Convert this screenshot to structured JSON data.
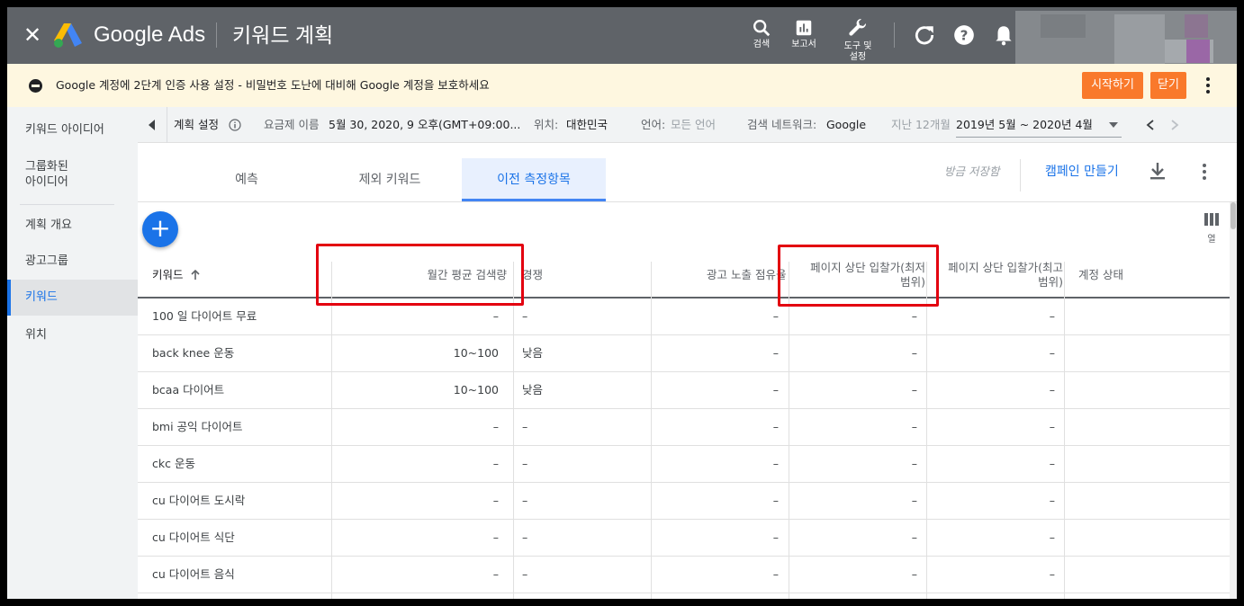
{
  "app": {
    "brand": "Google Ads",
    "page_title": "키워드 계획"
  },
  "toolbar": [
    {
      "label": "검색",
      "icon": "search-icon"
    },
    {
      "label": "보고서",
      "icon": "reports-icon"
    },
    {
      "label": "도구 및 설정",
      "icon": "wrench-icon"
    }
  ],
  "notice": {
    "text": "Google 계정에 2단계 인증 사용 설정 - 비밀번호 도난에 대비해 Google 계정을 보호하세요",
    "start_label": "시작하기",
    "close_label": "닫기"
  },
  "sidebar": {
    "items": [
      {
        "label": "키워드 아이디어"
      },
      {
        "label": "그룹화된\n아이디어"
      },
      {
        "label": "계획 개요"
      },
      {
        "label": "광고그룹"
      },
      {
        "label": "키워드",
        "active": true
      },
      {
        "label": "위치"
      }
    ]
  },
  "filter": {
    "plan_settings": "계획 설정",
    "plan_name_label": "요금제 이름",
    "plan_name": "5월 30, 2020, 9 오후(GMT+09:00...",
    "location_label": "위치:",
    "location": "대한민국",
    "language_label": "언어:",
    "language": "모든 언어",
    "network_label": "검색 네트워크:",
    "network": "Google",
    "period_label": "지난 12개월",
    "period": "2019년 5월 ~ 2020년 4월"
  },
  "tabs": [
    {
      "label": "예측"
    },
    {
      "label": "제외 키워드"
    },
    {
      "label": "이전 측정항목",
      "active": true
    }
  ],
  "actions": {
    "saved": "방금 저장함",
    "create_campaign": "캠페인 만들기",
    "columns_label": "열"
  },
  "table": {
    "headers": {
      "keyword": "키워드",
      "avg_searches": "월간 평균 검색량",
      "competition": "경쟁",
      "impression_share": "광고 노출 점유율",
      "bid_low": "페이지 상단 입찰가(최저\n범위)",
      "bid_high": "페이지 상단 입찰가(최고\n범위)",
      "status": "계정 상태"
    },
    "rows": [
      {
        "keyword": "100 일 다이어트 무료",
        "avg": "–",
        "comp": "–",
        "share": "–",
        "low": "–",
        "high": "–"
      },
      {
        "keyword": "back knee 운동",
        "avg": "10~100",
        "comp": "낮음",
        "share": "–",
        "low": "–",
        "high": "–"
      },
      {
        "keyword": "bcaa 다이어트",
        "avg": "10~100",
        "comp": "낮음",
        "share": "–",
        "low": "–",
        "high": "–"
      },
      {
        "keyword": "bmi 공익 다이어트",
        "avg": "–",
        "comp": "–",
        "share": "–",
        "low": "–",
        "high": "–"
      },
      {
        "keyword": "ckc 운동",
        "avg": "–",
        "comp": "–",
        "share": "–",
        "low": "–",
        "high": "–"
      },
      {
        "keyword": "cu 다이어트 도시락",
        "avg": "–",
        "comp": "–",
        "share": "–",
        "low": "–",
        "high": "–"
      },
      {
        "keyword": "cu 다이어트 식단",
        "avg": "–",
        "comp": "–",
        "share": "–",
        "low": "–",
        "high": "–"
      },
      {
        "keyword": "cu 다이어트 음식",
        "avg": "–",
        "comp": "–",
        "share": "–",
        "low": "–",
        "high": "–"
      }
    ]
  },
  "colors": {
    "topbar": "#5f6368",
    "accent": "#1a73e8",
    "orange_button": "#f9792b",
    "highlight_box": "#e3000f"
  }
}
